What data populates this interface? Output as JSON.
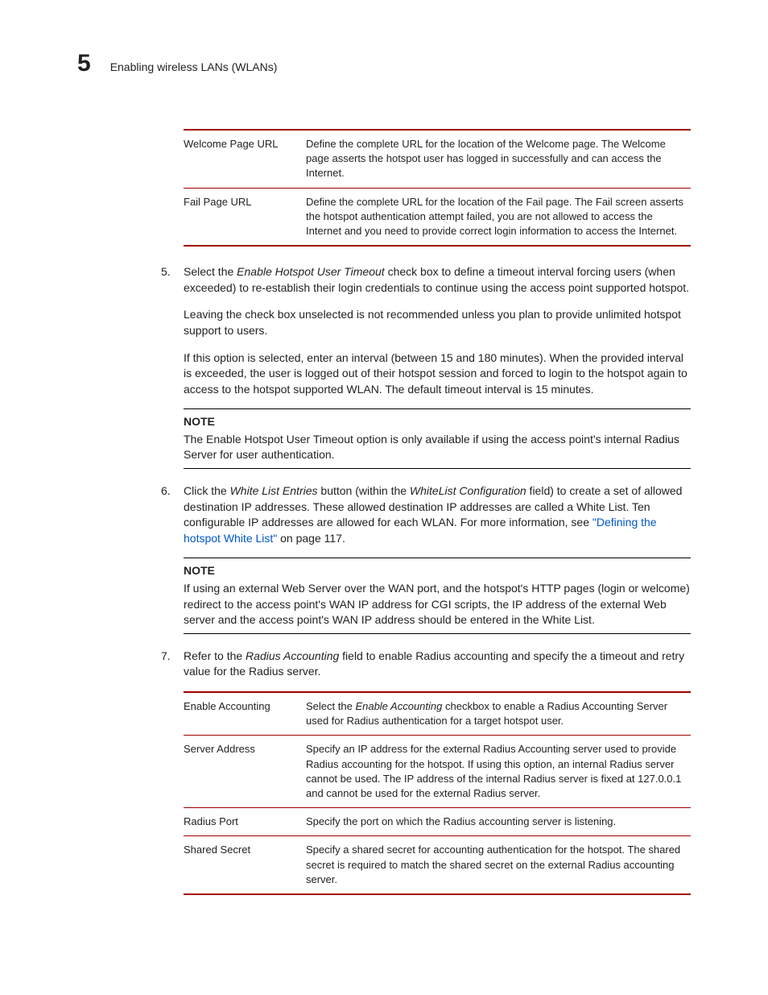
{
  "header": {
    "chapter": "5",
    "title": "Enabling wireless LANs (WLANs)"
  },
  "table1": {
    "rows": [
      {
        "term": "Welcome Page URL",
        "desc": "Define the complete URL for the location of the Welcome page. The Welcome page asserts the hotspot user has logged in successfully and can access the Internet."
      },
      {
        "term": "Fail Page URL",
        "desc": "Define the complete URL for the location of the Fail page. The Fail screen asserts the hotspot authentication attempt failed, you are not allowed to access the Internet and you need to provide correct login information to access the Internet."
      }
    ]
  },
  "step5": {
    "num": "5.",
    "p1a": "Select the ",
    "p1em": "Enable Hotspot User Timeout",
    "p1b": " check box to define a timeout interval forcing users (when exceeded) to re-establish their login credentials to continue using the access point supported hotspot.",
    "p2": "Leaving the check box unselected is not recommended unless you plan to provide unlimited hotspot support to users.",
    "p3": "If this option is selected, enter an interval (between 15 and 180 minutes). When the provided interval is exceeded, the user is logged out of their hotspot session and forced to login to the hotspot again to access to the hotspot supported WLAN. The default timeout interval is 15 minutes."
  },
  "note1": {
    "label": "NOTE",
    "text": "The Enable Hotspot User Timeout option is only available if using the access point's internal Radius Server for user authentication."
  },
  "step6": {
    "num": "6.",
    "p1a": "Click the ",
    "p1em1": "White List Entries",
    "p1b": " button (within the ",
    "p1em2": "WhiteList Configuration",
    "p1c": " field) to create a set of allowed destination IP addresses. These allowed destination IP addresses are called a White List. Ten configurable IP addresses are allowed for each WLAN. For more information, see ",
    "link": "\"Defining the hotspot White List\"",
    "p1d": " on page 117."
  },
  "note2": {
    "label": "NOTE",
    "text": "If using an external Web Server over the WAN port, and the hotspot's HTTP pages (login or welcome) redirect to the access point's WAN IP address for CGI scripts, the IP address of the external Web server and the access point's WAN IP address should be entered in the White List."
  },
  "step7": {
    "num": "7.",
    "p1a": "Refer to the ",
    "p1em": "Radius Accounting",
    "p1b": " field to enable Radius accounting and specify the a timeout and retry value for the Radius server."
  },
  "table2": {
    "rows": [
      {
        "term": "Enable Accounting",
        "descA": "Select the ",
        "descEm": "Enable Accounting",
        "descB": " checkbox to enable a Radius Accounting Server used for Radius authentication for a target hotspot user."
      },
      {
        "term": "Server Address",
        "descA": "Specify an IP address for the external Radius Accounting server used to provide Radius accounting for the hotspot. If using this option, an internal Radius server cannot be used. The IP address of the internal Radius server is fixed at 127.0.0.1 and cannot be used for the external Radius server.",
        "descEm": "",
        "descB": ""
      },
      {
        "term": "Radius Port",
        "descA": "Specify the port on which the Radius accounting server is listening.",
        "descEm": "",
        "descB": ""
      },
      {
        "term": "Shared Secret",
        "descA": "Specify a shared secret for accounting authentication for the hotspot. The shared secret is required to match the shared secret on the external Radius accounting server.",
        "descEm": "",
        "descB": ""
      }
    ]
  }
}
